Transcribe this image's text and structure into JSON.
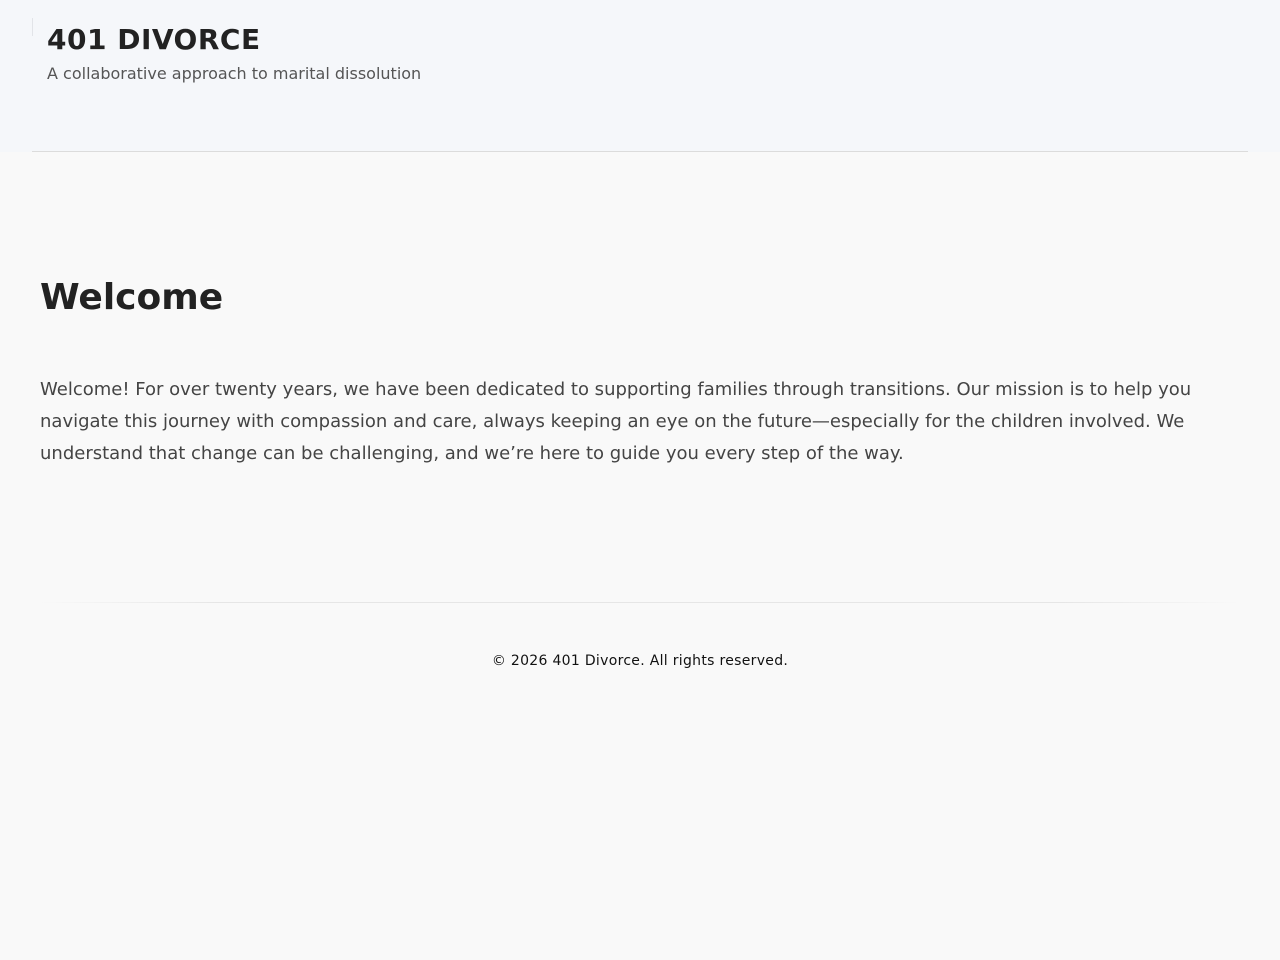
{
  "header": {
    "title": "401 DIVORCE",
    "tagline": "A collaborative approach to marital dissolution"
  },
  "main": {
    "heading": "Welcome",
    "intro": "Welcome! For over twenty years, we have been dedicated to supporting families through transitions. Our mission is to help you navigate this journey with compassion and care, always keeping an eye on the future—especially for the children involved. We understand that change can be challenging, and we’re here to guide you every step of the way."
  },
  "footer": {
    "copyright": "© 2026 401 Divorce. All rights reserved."
  }
}
